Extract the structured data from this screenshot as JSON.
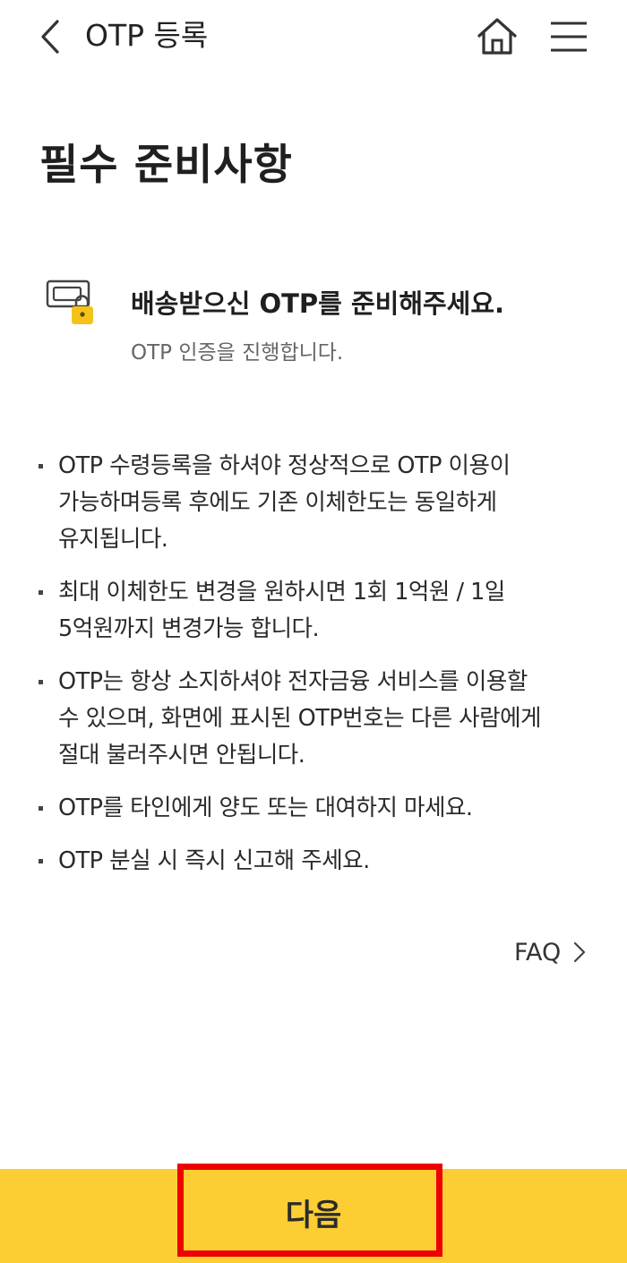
{
  "header": {
    "title": "OTP 등록",
    "back_icon": "chevron-left-icon",
    "home_icon": "home-icon",
    "menu_icon": "hamburger-menu-icon"
  },
  "page_title": "필수 준비사항",
  "notice": {
    "icon": "otp-card-lock-icon",
    "heading": "배송받으신 OTP를 준비해주세요.",
    "subtext": "OTP 인증을 진행합니다."
  },
  "bullets": [
    {
      "lines": [
        "OTP 수령등록을 하셔야 정상적으로 OTP 이용이",
        "가능하며등록 후에도 기존 이체한도는 동일하게",
        "유지됩니다."
      ]
    },
    {
      "lines": [
        "최대 이체한도 변경을 원하시면 1회 1억원 / 1일",
        "5억원까지 변경가능 합니다."
      ]
    },
    {
      "lines": [
        "OTP는 항상 소지하셔야 전자금융 서비스를 이용할",
        "수 있으며, 화면에 표시된 OTP번호는 다른 사람에게",
        "절대 불러주시면 안됩니다."
      ]
    },
    {
      "lines": [
        "OTP를 타인에게 양도 또는 대여하지 마세요."
      ]
    },
    {
      "lines": [
        "OTP 분실 시 즉시 신고해 주세요."
      ]
    }
  ],
  "faq": {
    "label": "FAQ",
    "icon": "chevron-right-icon"
  },
  "next_button": {
    "label": "다음"
  },
  "colors": {
    "accent_yellow": "#fcce33",
    "lock_yellow": "#f5c21b",
    "highlight_red": "#ee0000",
    "text_dark": "#222222",
    "text_gray": "#666666"
  }
}
